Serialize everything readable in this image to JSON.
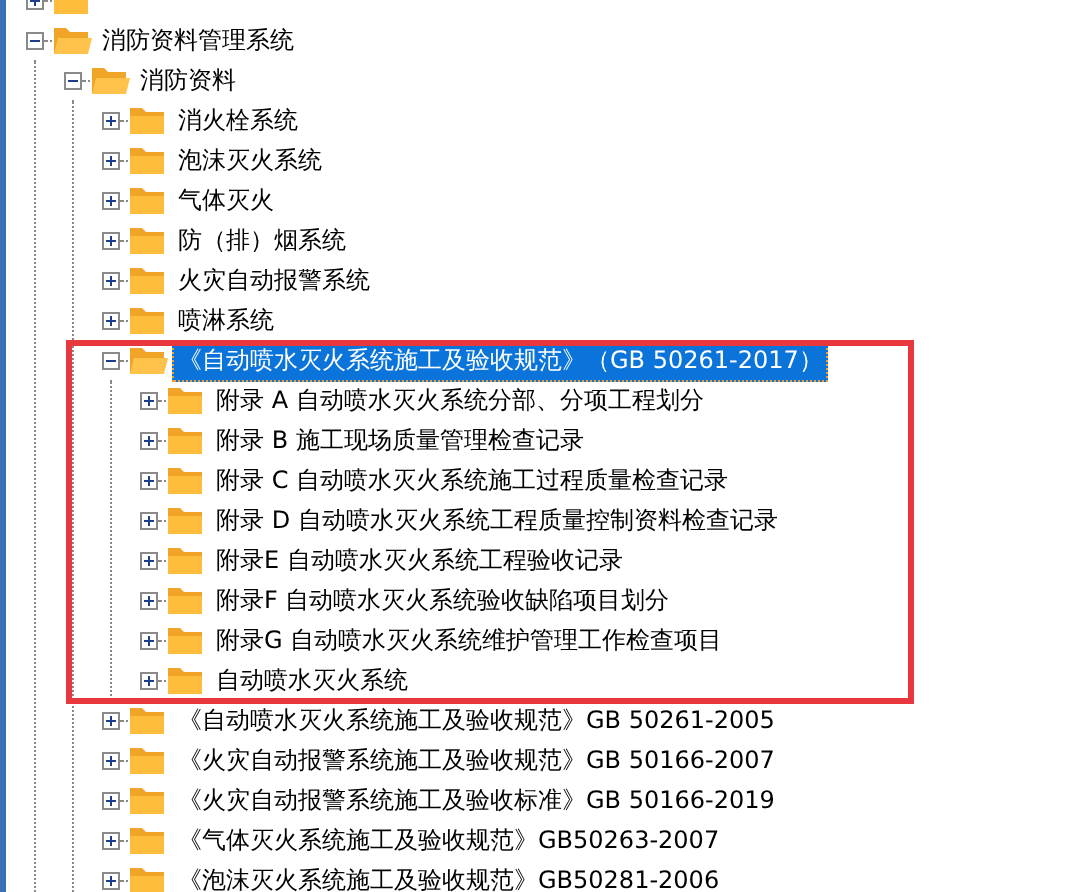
{
  "tree": [
    {
      "expanded": false
    },
    {
      "label": "消防资料管理系统",
      "expanded": true,
      "selected": false,
      "children": [
        {
          "label": "消防资料",
          "expanded": true,
          "selected": false,
          "children": [
            {
              "label": "消火栓系统",
              "expanded": false,
              "selected": false
            },
            {
              "label": "泡沫灭火系统",
              "expanded": false,
              "selected": false
            },
            {
              "label": "气体灭火",
              "expanded": false,
              "selected": false
            },
            {
              "label": "防（排）烟系统",
              "expanded": false,
              "selected": false
            },
            {
              "label": "火灾自动报警系统",
              "expanded": false,
              "selected": false
            },
            {
              "label": "喷淋系统",
              "expanded": false,
              "selected": false
            },
            {
              "label": "《自动喷水灭火系统施工及验收规范》（GB 50261-2017）",
              "expanded": true,
              "selected": true,
              "highlighted": true,
              "children": [
                {
                  "label": "附录 A 自动喷水灭火系统分部、分项工程划分",
                  "expanded": false,
                  "selected": false
                },
                {
                  "label": "附录 B 施工现场质量管理检查记录",
                  "expanded": false,
                  "selected": false
                },
                {
                  "label": "附录 C 自动喷水灭火系统施工过程质量检查记录",
                  "expanded": false,
                  "selected": false
                },
                {
                  "label": "附录 D 自动喷水灭火系统工程质量控制资料检查记录",
                  "expanded": false,
                  "selected": false
                },
                {
                  "label": "附录E 自动喷水灭火系统工程验收记录",
                  "expanded": false,
                  "selected": false
                },
                {
                  "label": "附录F 自动喷水灭火系统验收缺陷项目划分",
                  "expanded": false,
                  "selected": false
                },
                {
                  "label": "附录G 自动喷水灭火系统维护管理工作检查项目",
                  "expanded": false,
                  "selected": false
                },
                {
                  "label": "自动喷水灭火系统",
                  "expanded": false,
                  "selected": false
                }
              ]
            },
            {
              "label": "《自动喷水灭火系统施工及验收规范》GB 50261-2005",
              "expanded": false,
              "selected": false
            },
            {
              "label": "《火灾自动报警系统施工及验收规范》GB 50166-2007",
              "expanded": false,
              "selected": false
            },
            {
              "label": "《火灾自动报警系统施工及验收标准》GB 50166-2019",
              "expanded": false,
              "selected": false
            },
            {
              "label": "《气体灭火系统施工及验收规范》GB50263-2007",
              "expanded": false,
              "selected": false
            },
            {
              "label": "《泡沫灭火系统施工及验收规范》GB50281-2006",
              "expanded": false,
              "selected": false
            }
          ]
        }
      ]
    }
  ]
}
